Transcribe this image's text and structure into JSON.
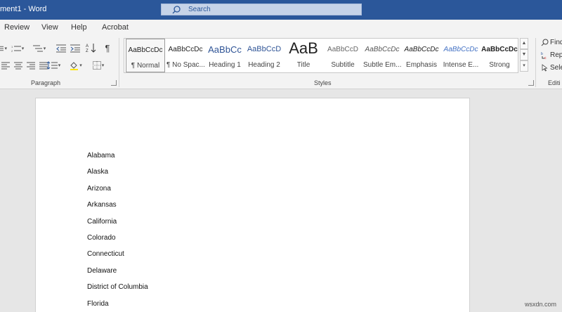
{
  "titlebar": {
    "doc_title": "ment1  -  Word",
    "search_placeholder": "Search"
  },
  "menu": [
    "Review",
    "View",
    "Help",
    "Acrobat"
  ],
  "ribbon": {
    "paragraph_label": "Paragraph",
    "styles_label": "Styles",
    "editing_label": "Editi",
    "styles": [
      {
        "preview": "AaBbCcDc",
        "name": "¶ Normal"
      },
      {
        "preview": "AaBbCcDc",
        "name": "¶ No Spac..."
      },
      {
        "preview": "AaBbCc",
        "name": "Heading 1"
      },
      {
        "preview": "AaBbCcD",
        "name": "Heading 2"
      },
      {
        "preview": "AaB",
        "name": "Title"
      },
      {
        "preview": "AaBbCcD",
        "name": "Subtitle"
      },
      {
        "preview": "AaBbCcDc",
        "name": "Subtle Em..."
      },
      {
        "preview": "AaBbCcDc",
        "name": "Emphasis"
      },
      {
        "preview": "AaBbCcDc",
        "name": "Intense E..."
      },
      {
        "preview": "AaBbCcDc",
        "name": "Strong"
      }
    ],
    "editing": {
      "find": "Find",
      "replace": "Rep",
      "select": "Sele"
    }
  },
  "document": {
    "lines": [
      "Alabama",
      "Alaska",
      "Arizona",
      "Arkansas",
      "California",
      "Colorado",
      "Connecticut",
      "Delaware",
      "District of Columbia",
      "Florida"
    ]
  },
  "watermark": "wsxdn.com",
  "colors": {
    "titlebar": "#2b579a",
    "heading_blue": "#2f5496",
    "intense_blue": "#4472c4"
  }
}
